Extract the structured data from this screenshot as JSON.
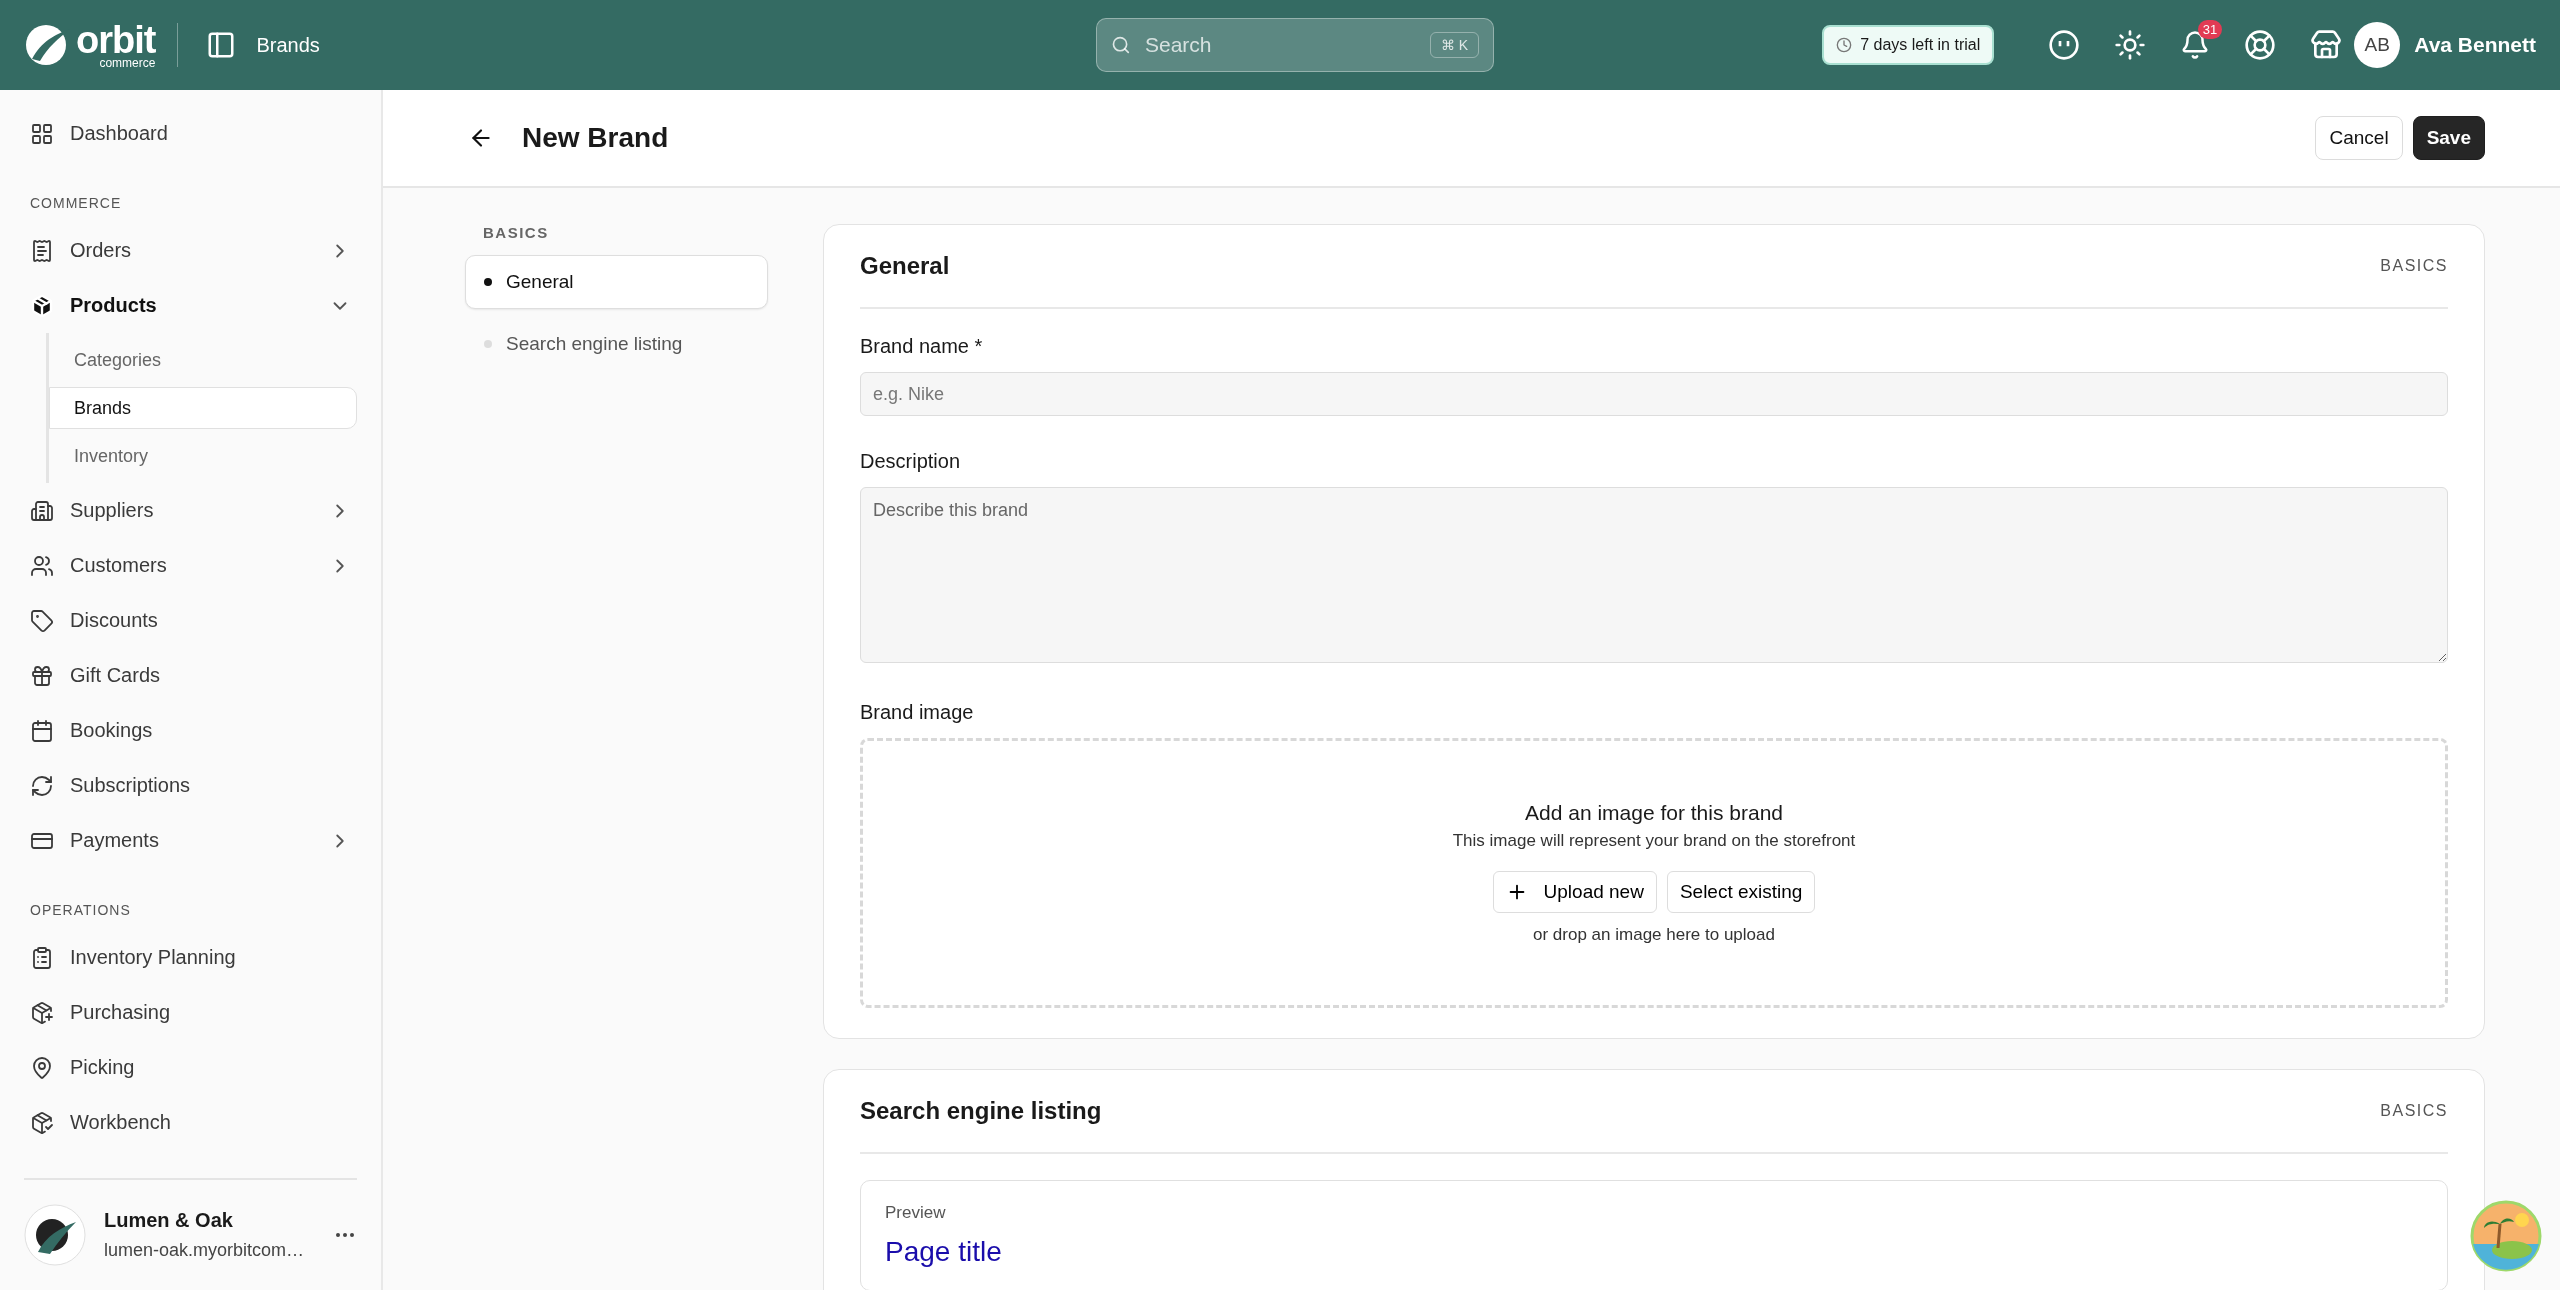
{
  "topbar": {
    "logo": {
      "name": "orbit",
      "tagline": "commerce"
    },
    "breadcrumb": "Brands",
    "search": {
      "placeholder": "Search",
      "shortcut": "⌘ K"
    },
    "trial": "7 days left in trial",
    "notifications": "31",
    "user": {
      "initials": "AB",
      "name": "Ava Bennett"
    }
  },
  "sidebar": {
    "groups": [
      {
        "items": [
          {
            "label": "Dashboard",
            "selected": false
          }
        ]
      },
      {
        "title": "COMMERCE",
        "items": [
          {
            "label": "Orders",
            "selected": false,
            "expanded": false
          },
          {
            "label": "Products",
            "selected": true,
            "expanded": true,
            "children": [
              {
                "label": "Categories",
                "selected": false
              },
              {
                "label": "Brands",
                "selected": true
              },
              {
                "label": "Inventory",
                "selected": false
              }
            ]
          },
          {
            "label": "Suppliers",
            "selected": false,
            "expanded": false
          },
          {
            "label": "Customers",
            "selected": false,
            "expanded": false
          },
          {
            "label": "Discounts",
            "selected": false
          },
          {
            "label": "Gift Cards",
            "selected": false
          },
          {
            "label": "Bookings",
            "selected": false
          },
          {
            "label": "Subscriptions",
            "selected": false
          },
          {
            "label": "Payments",
            "selected": false,
            "expanded": false
          }
        ]
      },
      {
        "title": "OPERATIONS",
        "items": [
          {
            "label": "Inventory Planning",
            "selected": false
          },
          {
            "label": "Purchasing",
            "selected": false
          },
          {
            "label": "Picking",
            "selected": false
          },
          {
            "label": "Workbench",
            "selected": false
          }
        ]
      }
    ],
    "workspace": {
      "name": "Lumen & Oak",
      "domain": "lumen-oak.myorbitcom…"
    }
  },
  "header": {
    "title": "New Brand",
    "buttons": [
      {
        "label": "Cancel",
        "kind": "secondary"
      },
      {
        "label": "Save",
        "kind": "primary"
      }
    ]
  },
  "subnav": {
    "title": "BASICS",
    "items": [
      {
        "label": "General",
        "selected": true
      },
      {
        "label": "Search engine listing",
        "selected": false
      }
    ]
  },
  "cards": [
    {
      "title": "General",
      "tag": "BASICS",
      "fields": [
        {
          "kind": "input",
          "label": "Brand name *",
          "placeholder": "e.g. Nike"
        },
        {
          "kind": "textarea",
          "label": "Description",
          "placeholder": "Describe this brand"
        },
        {
          "kind": "upload",
          "label": "Brand image",
          "title": "Add an image for this brand",
          "hint": "This image will represent your brand on the storefront",
          "buttons": [
            "Upload new",
            "Select existing"
          ],
          "note": "or drop an image here to upload"
        }
      ]
    },
    {
      "title": "Search engine listing",
      "tag": "BASICS",
      "fields": [
        {
          "kind": "preview",
          "label": "Preview",
          "title": "Page title"
        }
      ]
    }
  ]
}
